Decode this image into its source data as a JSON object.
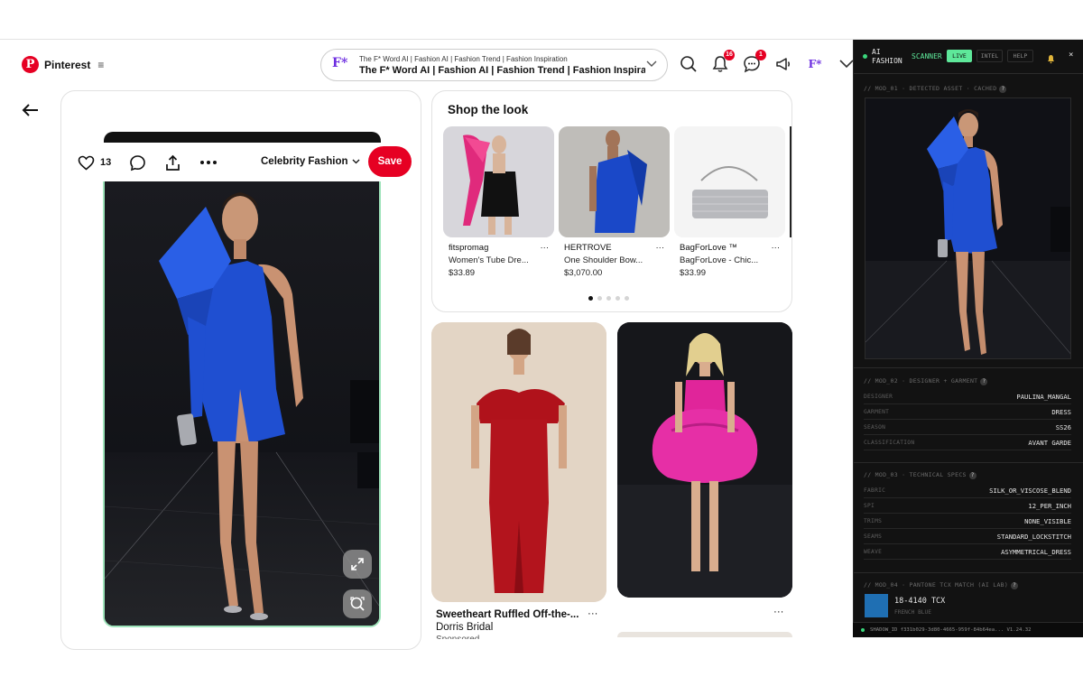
{
  "header": {
    "brand": "Pinterest",
    "menu_glyph": "≡",
    "search_small": "The F* Word AI | Fashion AI | Fashion Trend | Fashion Inspiration",
    "search_big": "The F* Word AI | Fashion AI | Fashion Trend | Fashion Inspiration",
    "search_badge": "F*",
    "notifications_count": "16",
    "messages_count": "1",
    "avatar_label": "F*"
  },
  "pin": {
    "like_count": "13",
    "board": "Celebrity Fashion",
    "save_label": "Save"
  },
  "shop": {
    "title": "Shop the look",
    "products": [
      {
        "seller": "fitspromag",
        "name": "Women's Tube Dre...",
        "price": "$33.89"
      },
      {
        "seller": "HERTROVE",
        "name": "One Shoulder Bow...",
        "price": "$3,070.00"
      },
      {
        "seller": "BagForLove ™",
        "name": "BagForLove - Chic...",
        "price": "$33.99"
      }
    ],
    "more_glyph": "···"
  },
  "grid": {
    "pin1_title": "Sweetheart Ruffled Off-the-...",
    "pin1_subtitle": "Dorris Bridal",
    "pin1_meta": "Sponsored",
    "more_glyph": "···"
  },
  "scanner": {
    "title_line1": "AI",
    "title_line2": "FASHION",
    "title_accent": "SCANNER",
    "live": "LIVE",
    "tab_intel": "INTEL",
    "tab_help": "HELP",
    "mod1": "// MOD_01 · DETECTED ASSET · CACHED",
    "mod2": "// MOD_02 · DESIGNER + GARMENT",
    "mod3": "// MOD_03 · TECHNICAL SPECS",
    "mod4": "// MOD_04 · PANTONE TCX MATCH (AI LAB)",
    "rows_mod2": [
      {
        "k": "DESIGNER",
        "v": "PAULINA_MANGAL"
      },
      {
        "k": "GARMENT",
        "v": "DRESS"
      },
      {
        "k": "SEASON",
        "v": "SS26"
      },
      {
        "k": "CLASSIFICATION",
        "v": "AVANT GARDE"
      }
    ],
    "rows_mod3": [
      {
        "k": "FABRIC",
        "v": "SILK_OR_VISCOSE_BLEND"
      },
      {
        "k": "SPI",
        "v": "12_PER_INCH"
      },
      {
        "k": "TRIMS",
        "v": "NONE_VISIBLE"
      },
      {
        "k": "SEAMS",
        "v": "STANDARD_LOCKSTITCH"
      },
      {
        "k": "WEAVE",
        "v": "ASYMMETRICAL_DRESS"
      }
    ],
    "pantone_code": "18-4140 TCX",
    "pantone_name": "FRENCH BLUE",
    "pantone_hex": "#1f6fb3",
    "footer": "SHADOW_ID  f331b029-3d80-4665-959f-84b64ea...  V1.24.32"
  },
  "colors": {
    "brand_red": "#e60023",
    "accent_green": "#5ee89a",
    "dress_blue": "#1f4fd1"
  }
}
